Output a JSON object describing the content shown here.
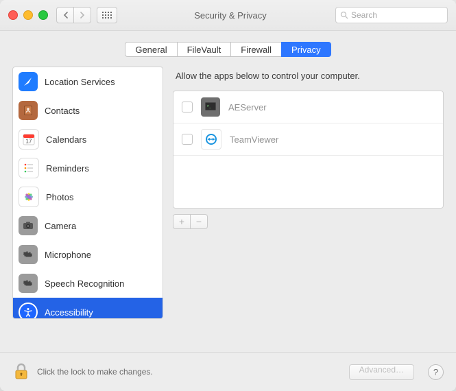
{
  "window": {
    "title": "Security & Privacy"
  },
  "search": {
    "placeholder": "Search"
  },
  "tabs": [
    {
      "label": "General",
      "active": false
    },
    {
      "label": "FileVault",
      "active": false
    },
    {
      "label": "Firewall",
      "active": false
    },
    {
      "label": "Privacy",
      "active": true
    }
  ],
  "sidebar": {
    "items": [
      {
        "label": "Location Services",
        "icon": "compass-icon",
        "color": "#1f7cff"
      },
      {
        "label": "Contacts",
        "icon": "book-icon",
        "color": "#b4683e"
      },
      {
        "label": "Calendars",
        "icon": "calendar-icon",
        "color": "#ffffff"
      },
      {
        "label": "Reminders",
        "icon": "reminders-icon",
        "color": "#ffffff"
      },
      {
        "label": "Photos",
        "icon": "photos-icon",
        "color": "#ffffff"
      },
      {
        "label": "Camera",
        "icon": "camera-icon",
        "color": "#9b9b9b"
      },
      {
        "label": "Microphone",
        "icon": "microphone-icon",
        "color": "#9b9b9b"
      },
      {
        "label": "Speech Recognition",
        "icon": "speech-icon",
        "color": "#9b9b9b"
      },
      {
        "label": "Accessibility",
        "icon": "accessibility-icon",
        "color": "#1f66ff",
        "selected": true
      }
    ]
  },
  "main": {
    "description": "Allow the apps below to control your computer.",
    "apps": [
      {
        "name": "AEServer",
        "checked": false,
        "icon": "terminal-icon",
        "icon_bg": "#6f6f6f"
      },
      {
        "name": "TeamViewer",
        "checked": false,
        "icon": "teamviewer-icon",
        "icon_bg": "#1b95e0"
      }
    ],
    "add_label": "+",
    "remove_label": "−"
  },
  "footer": {
    "lock_text": "Click the lock to make changes.",
    "advanced_label": "Advanced…",
    "help_label": "?"
  }
}
